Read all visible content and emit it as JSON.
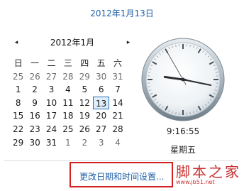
{
  "header": {
    "date_text": "2012年1月13日"
  },
  "calendar": {
    "prev_icon": "◂",
    "next_icon": "▸",
    "month_label": "2012年1月",
    "weekdays": [
      "日",
      "一",
      "二",
      "三",
      "四",
      "五",
      "六"
    ],
    "weeks": [
      [
        "25",
        "26",
        "27",
        "28",
        "29",
        "30",
        "31"
      ],
      [
        "1",
        "2",
        "3",
        "4",
        "5",
        "6",
        "7"
      ],
      [
        "8",
        "9",
        "10",
        "11",
        "12",
        "13",
        "14"
      ],
      [
        "15",
        "16",
        "17",
        "18",
        "19",
        "20",
        "21"
      ],
      [
        "22",
        "23",
        "24",
        "25",
        "26",
        "27",
        "28"
      ],
      [
        "29",
        "30",
        "31",
        "1",
        "2",
        "3",
        "4"
      ]
    ],
    "selected_day": "13"
  },
  "clock": {
    "time_text": "9:16:55",
    "weekday_text": "星期五",
    "hour": 9,
    "minute": 16,
    "second": 55
  },
  "footer": {
    "settings_link": "更改日期和时间设置..."
  },
  "watermark": {
    "brand": "脚本之家",
    "url": "www.jb51.net"
  },
  "colors": {
    "accent_blue": "#1f5fa8",
    "highlight_red": "#d32020"
  }
}
